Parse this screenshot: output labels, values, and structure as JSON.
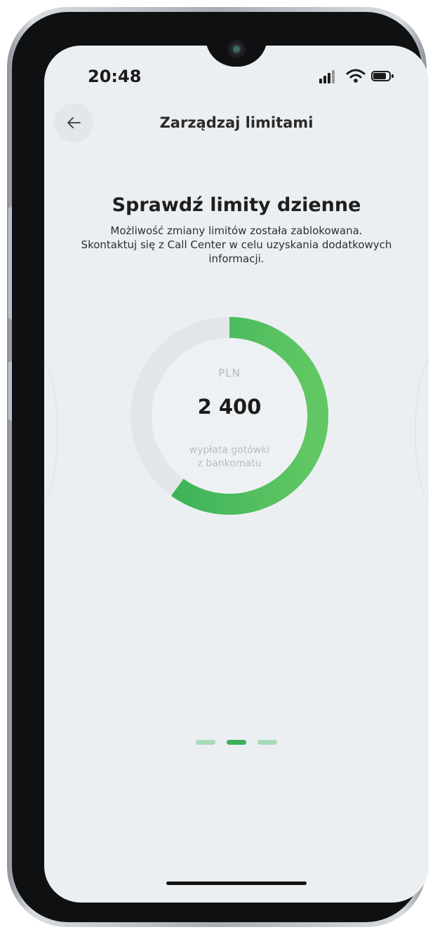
{
  "status_bar": {
    "time": "20:48"
  },
  "header": {
    "title": "Zarządzaj limitami",
    "back_icon": "arrow-left-icon"
  },
  "limit_card": {
    "title": "Sprawdź limity dzienne",
    "description": "Możliwość zmiany limitów została zablokowana.\nSkontaktuj się z Call Center w celu uzyskania dodatkowych informacji.",
    "currency": "PLN",
    "amount": "2 400",
    "caption": "wypłata gotówki\nz bankomatu",
    "fill_fraction": 0.6
  },
  "pager": {
    "count": 3,
    "active_index": 1
  },
  "colors": {
    "accent": "#3bb15c",
    "accent_light": "#a9dcb8",
    "track": "#e3e6e8",
    "background": "#eceff2"
  }
}
